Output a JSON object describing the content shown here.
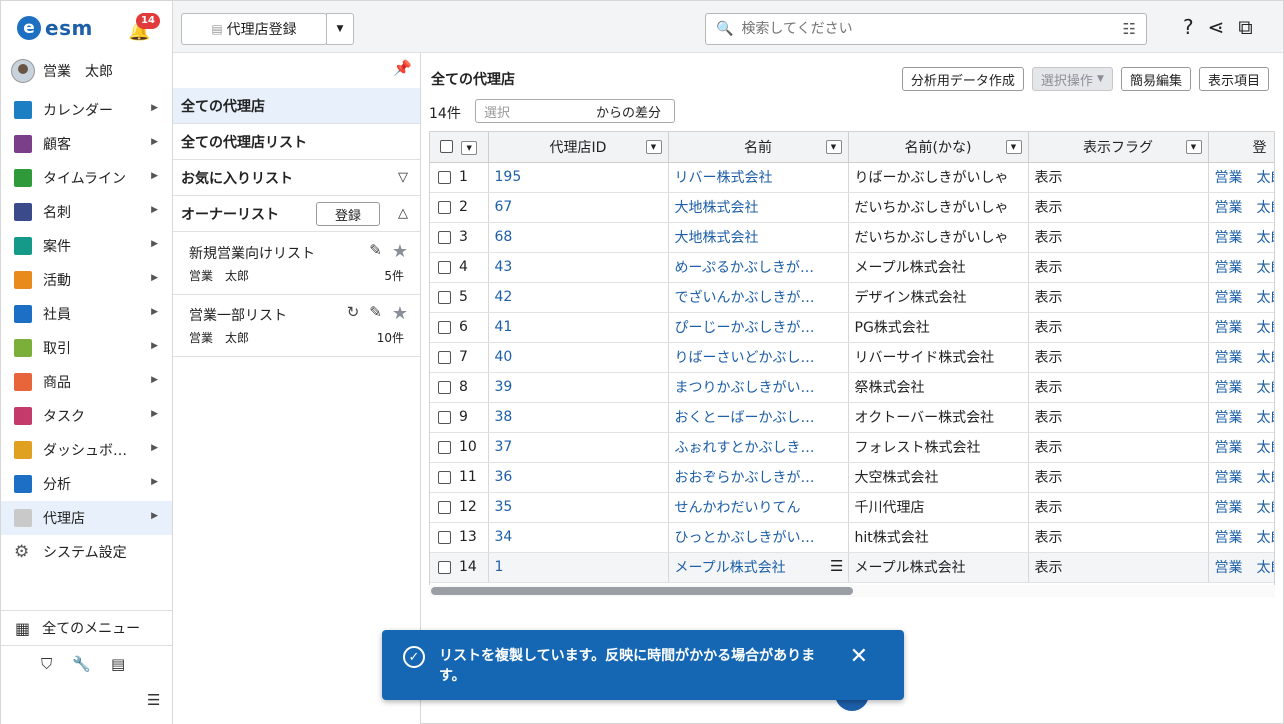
{
  "app": {
    "logo_text": "esm",
    "logo_letter": "e",
    "notification_count": "14"
  },
  "user": {
    "name": "営業　太郎"
  },
  "nav": {
    "items": [
      {
        "label": "カレンダー",
        "icon": "calendar-icon",
        "color": "#1c7fc4"
      },
      {
        "label": "顧客",
        "icon": "building-icon",
        "color": "#7b3f8a"
      },
      {
        "label": "タイムライン",
        "icon": "chat-icon",
        "color": "#2e9a3a"
      },
      {
        "label": "名刺",
        "icon": "card-icon",
        "color": "#3a4a8a"
      },
      {
        "label": "案件",
        "icon": "folder-icon",
        "color": "#159a8a"
      },
      {
        "label": "活動",
        "icon": "clipboard-icon",
        "color": "#e98a1c"
      },
      {
        "label": "社員",
        "icon": "person-icon",
        "color": "#1c6fc4"
      },
      {
        "label": "取引",
        "icon": "ledger-icon",
        "color": "#7ab03a"
      },
      {
        "label": "商品",
        "icon": "box-icon",
        "color": "#e8643a"
      },
      {
        "label": "タスク",
        "icon": "check-icon",
        "color": "#c43a6a"
      },
      {
        "label": "ダッシュボ…",
        "icon": "dashboard-icon",
        "color": "#e0a020"
      },
      {
        "label": "分析",
        "icon": "chart-icon",
        "color": "#1c6fc4"
      },
      {
        "label": "代理店",
        "icon": "document-icon",
        "color": "#c9c9c9"
      },
      {
        "label": "システム設定",
        "icon": "gear-icon",
        "color": "#555555"
      }
    ],
    "all_menu": "全てのメニュー"
  },
  "topbar": {
    "register_label": "代理店登録",
    "search_placeholder": "検索してください"
  },
  "lists": {
    "all_agencies": "全ての代理店",
    "all_lists": "全ての代理店リスト",
    "favorites": "お気に入りリスト",
    "owner_lists": "オーナーリスト",
    "register_small": "登録",
    "cards": [
      {
        "title": "新規営業向けリスト",
        "owner": "営業　太郎",
        "count": "5件"
      },
      {
        "title": "営業一部リスト",
        "owner": "営業　太郎",
        "count": "10件"
      }
    ]
  },
  "main": {
    "title": "全ての代理店",
    "buttons": {
      "export": "分析用データ作成",
      "selection": "選択操作",
      "quick_edit": "簡易編集",
      "columns": "表示項目"
    },
    "count": "14件",
    "diff_placeholder": "選択",
    "diff_suffix": "からの差分"
  },
  "table": {
    "headers": [
      "代理店ID",
      "名前",
      "名前(かな)",
      "表示フラグ",
      "登"
    ],
    "rows": [
      {
        "n": "1",
        "id": "195",
        "name": "リバー株式会社",
        "kana": "りばーかぶしきがいしゃ",
        "flag": "表示",
        "reg": "営業　太郎"
      },
      {
        "n": "2",
        "id": "67",
        "name": "大地株式会社",
        "kana": "だいちかぶしきがいしゃ",
        "flag": "表示",
        "reg": "営業　太郎"
      },
      {
        "n": "3",
        "id": "68",
        "name": "大地株式会社",
        "kana": "だいちかぶしきがいしゃ",
        "flag": "表示",
        "reg": "営業　太郎"
      },
      {
        "n": "4",
        "id": "43",
        "name": "めーぷるかぶしきが…",
        "kana": "メープル株式会社",
        "flag": "表示",
        "reg": "営業　太郎"
      },
      {
        "n": "5",
        "id": "42",
        "name": "でざいんかぶしきが…",
        "kana": "デザイン株式会社",
        "flag": "表示",
        "reg": "営業　太郎"
      },
      {
        "n": "6",
        "id": "41",
        "name": "ぴーじーかぶしきが…",
        "kana": "PG株式会社",
        "flag": "表示",
        "reg": "営業　太郎"
      },
      {
        "n": "7",
        "id": "40",
        "name": "りばーさいどかぶし…",
        "kana": "リバーサイド株式会社",
        "flag": "表示",
        "reg": "営業　太郎"
      },
      {
        "n": "8",
        "id": "39",
        "name": "まつりかぶしきがい…",
        "kana": "祭株式会社",
        "flag": "表示",
        "reg": "営業　太郎"
      },
      {
        "n": "9",
        "id": "38",
        "name": "おくとーばーかぶし…",
        "kana": "オクトーバー株式会社",
        "flag": "表示",
        "reg": "営業　太郎"
      },
      {
        "n": "10",
        "id": "37",
        "name": "ふぉれすとかぶしき…",
        "kana": "フォレスト株式会社",
        "flag": "表示",
        "reg": "営業　太郎"
      },
      {
        "n": "11",
        "id": "36",
        "name": "おおぞらかぶしきが…",
        "kana": "大空株式会社",
        "flag": "表示",
        "reg": "営業　太郎"
      },
      {
        "n": "12",
        "id": "35",
        "name": "せんかわだいりてん",
        "kana": "千川代理店",
        "flag": "表示",
        "reg": "営業　太郎"
      },
      {
        "n": "13",
        "id": "34",
        "name": "ひっとかぶしきがい…",
        "kana": "hit株式会社",
        "flag": "表示",
        "reg": "営業　太郎"
      },
      {
        "n": "14",
        "id": "1",
        "name": "メープル株式会社",
        "kana": "メープル株式会社",
        "flag": "表示",
        "reg": "営業　太郎"
      }
    ]
  },
  "toast": {
    "message": "リストを複製しています。反映に時間がかかる場合があります。"
  }
}
